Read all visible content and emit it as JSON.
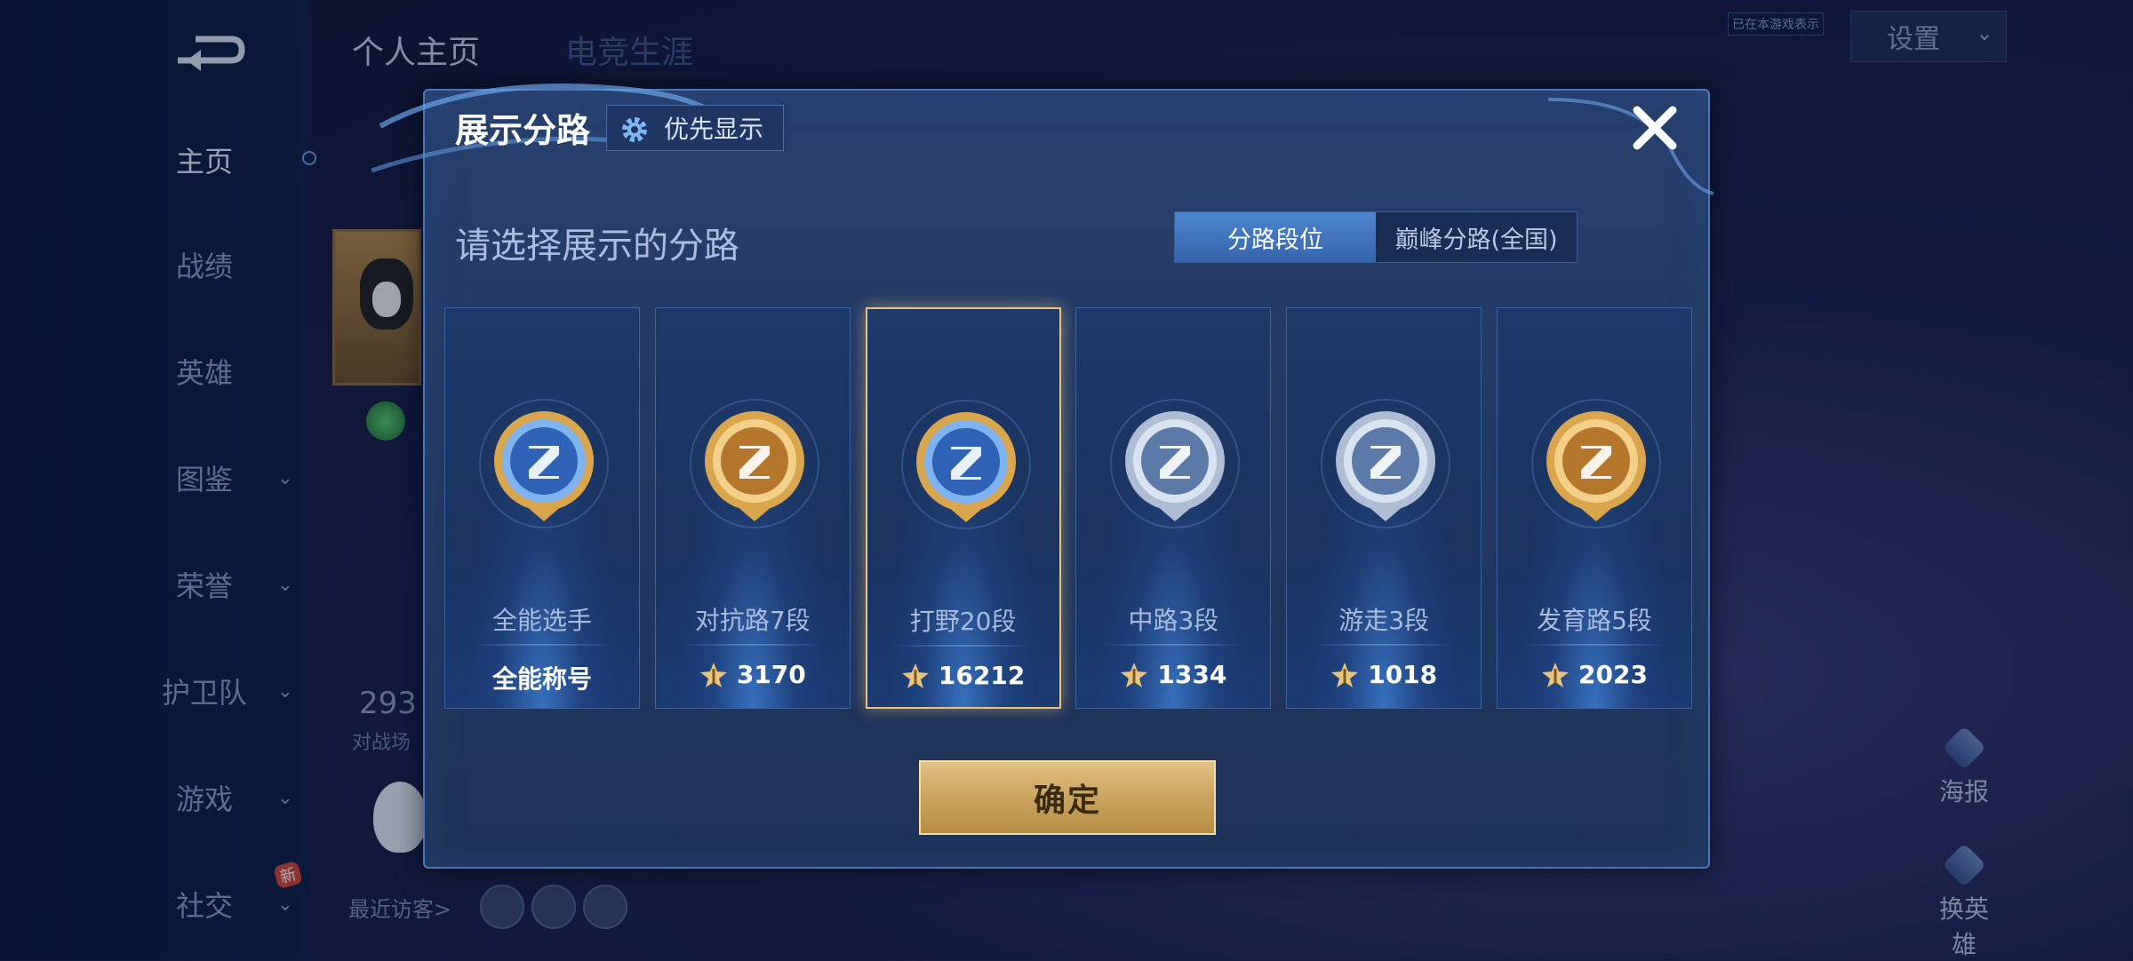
{
  "background": {
    "sidebar": {
      "items": [
        {
          "label": "主页",
          "active": true,
          "chevron": false
        },
        {
          "label": "战绩",
          "active": false,
          "chevron": false
        },
        {
          "label": "英雄",
          "active": false,
          "chevron": false
        },
        {
          "label": "图鉴",
          "active": false,
          "chevron": true
        },
        {
          "label": "荣誉",
          "active": false,
          "chevron": true
        },
        {
          "label": "护卫队",
          "active": false,
          "chevron": true
        },
        {
          "label": "游戏",
          "active": false,
          "chevron": true
        },
        {
          "label": "社交",
          "active": false,
          "chevron": true,
          "badge": "新"
        }
      ]
    },
    "tabs": [
      "个人主页",
      "电竞生涯"
    ],
    "status_note": "已在本游戏表示",
    "settings_label": "设置",
    "stat_value": "293",
    "stat_label": "对战场",
    "visitors_label": "最近访客>",
    "right_buttons": [
      "海报",
      "换英雄"
    ]
  },
  "modal": {
    "title": "展示分路",
    "priority_label": "优先显示",
    "subtitle": "请选择展示的分路",
    "segments": [
      {
        "label": "分路段位",
        "active": true
      },
      {
        "label": "巅峰分路(全国)",
        "active": false
      }
    ],
    "cards": [
      {
        "name": "全能选手",
        "value": "全能称号",
        "has_star": false,
        "selected": false,
        "badge_icon": "all-round-badge-icon",
        "tone": "blue"
      },
      {
        "name": "对抗路7段",
        "value": "3170",
        "has_star": true,
        "selected": false,
        "badge_icon": "clash-lane-badge-icon",
        "tone": "gold"
      },
      {
        "name": "打野20段",
        "value": "16212",
        "has_star": true,
        "selected": true,
        "badge_icon": "jungle-badge-icon",
        "tone": "blue"
      },
      {
        "name": "中路3段",
        "value": "1334",
        "has_star": true,
        "selected": false,
        "badge_icon": "mid-lane-badge-icon",
        "tone": "silver"
      },
      {
        "name": "游走3段",
        "value": "1018",
        "has_star": true,
        "selected": false,
        "badge_icon": "roam-badge-icon",
        "tone": "silver"
      },
      {
        "name": "发育路5段",
        "value": "2023",
        "has_star": true,
        "selected": false,
        "badge_icon": "farm-lane-badge-icon",
        "tone": "gold"
      }
    ],
    "confirm_label": "确定"
  },
  "colors": {
    "accent_gold": "#e8c47e",
    "segment_active": "#3f74bd",
    "modal_bg": "#253d69"
  }
}
